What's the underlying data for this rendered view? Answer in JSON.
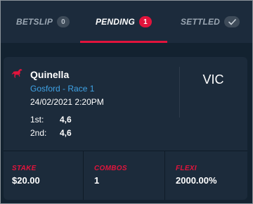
{
  "tabs": [
    {
      "label": "BETSLIP",
      "badge": "0",
      "active": false
    },
    {
      "label": "PENDING",
      "badge": "1",
      "active": true
    },
    {
      "label": "SETTLED",
      "badge_icon": "check-icon",
      "active": false
    }
  ],
  "bet": {
    "icon": "horse-icon",
    "type": "Quinella",
    "race": "Gosford - Race 1",
    "datetime": "24/02/2021 2:20PM",
    "selections": [
      {
        "label": "1st:",
        "value": "4,6"
      },
      {
        "label": "2nd:",
        "value": "4,6"
      }
    ],
    "venue": "VIC"
  },
  "stats": [
    {
      "label": "STAKE",
      "value": "$20.00"
    },
    {
      "label": "COMBOS",
      "value": "1"
    },
    {
      "label": "FLEXI",
      "value": "2000.00%"
    }
  ],
  "colors": {
    "accent": "#e1143c",
    "link": "#3fa3e6",
    "background": "#132230",
    "card": "#1c2b3b"
  }
}
